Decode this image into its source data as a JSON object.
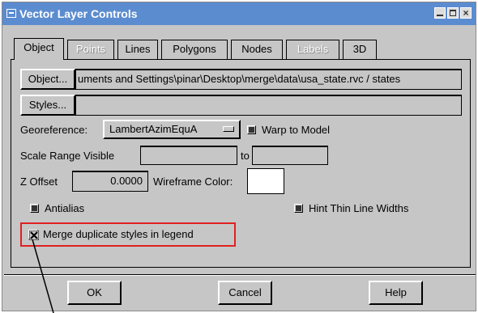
{
  "window": {
    "title": "Vector Layer Controls"
  },
  "tabs": [
    {
      "label": "Object",
      "state": "active"
    },
    {
      "label": "Points",
      "state": "disabled"
    },
    {
      "label": "Lines",
      "state": "enabled"
    },
    {
      "label": "Polygons",
      "state": "enabled"
    },
    {
      "label": "Nodes",
      "state": "enabled"
    },
    {
      "label": "Labels",
      "state": "disabled"
    },
    {
      "label": "3D",
      "state": "enabled"
    }
  ],
  "object": {
    "button_label": "Object...",
    "path_value": "uments and Settings\\pinar\\Desktop\\merge\\data\\usa_state.rvc / states"
  },
  "styles": {
    "button_label": "Styles...",
    "value": ""
  },
  "georeference": {
    "label": "Georeference:",
    "selected": "LambertAzimEquA",
    "warp_label": "Warp to Model",
    "warp_checked": false
  },
  "scale_range": {
    "label": "Scale Range Visible",
    "to_label": "to",
    "from_value": "",
    "to_value": ""
  },
  "z_offset": {
    "label": "Z Offset",
    "value": "0.0000",
    "wireframe_label": "Wireframe Color:"
  },
  "options": {
    "antialias_label": "Antialias",
    "antialias_checked": false,
    "hint_label": "Hint Thin Line Widths",
    "hint_checked": false,
    "merge_label": "Merge duplicate styles in legend",
    "merge_checked": true
  },
  "footer": {
    "ok_label": "OK",
    "cancel_label": "Cancel",
    "help_label": "Help"
  },
  "colors": {
    "titlebar": "#5b8cd0",
    "dialog_bg": "#c6c6c6",
    "highlight": "#e02020"
  }
}
